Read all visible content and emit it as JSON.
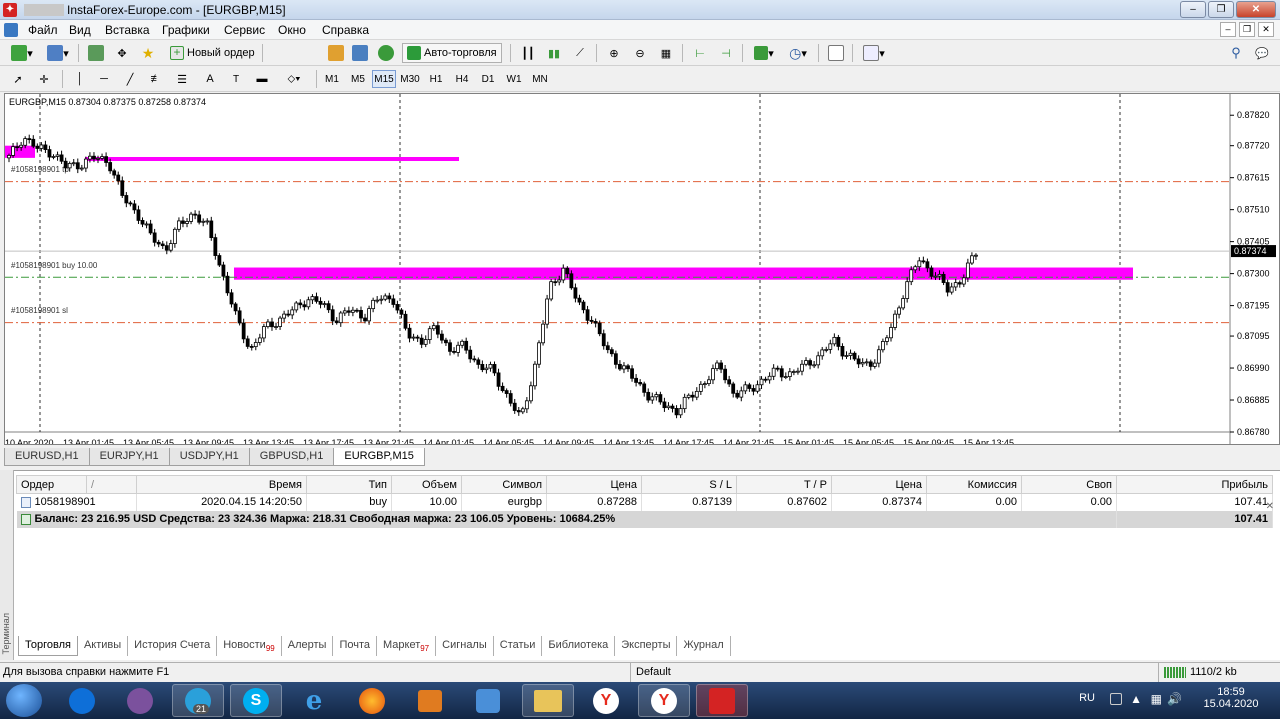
{
  "window": {
    "title": "InstaForex-Europe.com - [EURGBP,M15]",
    "buttons": [
      "–",
      "❐",
      "✕"
    ]
  },
  "menu": [
    "Файл",
    "Вид",
    "Вставка",
    "Графики",
    "Сервис",
    "Окно",
    "Справка"
  ],
  "toolbar": {
    "new_order": "Новый ордер",
    "auto_trading": "Авто-торговля",
    "draw_text": "A"
  },
  "timeframes": [
    "M1",
    "M5",
    "M15",
    "M30",
    "H1",
    "H4",
    "D1",
    "W1",
    "MN"
  ],
  "active_timeframe": "M15",
  "chart": {
    "header": "EURGBP,M15  0.87304 0.87375 0.87258 0.87374",
    "label_tp": "#1058198901 tp",
    "label_buy": "#1058198901 buy 10.00",
    "label_sl": "#1058198901 sl",
    "price_labels": [
      "0.87820",
      "0.87720",
      "0.87615",
      "0.87510",
      "0.87405",
      "0.87300",
      "0.87195",
      "0.87095",
      "0.86990",
      "0.86885",
      "0.86780"
    ],
    "current_price": "0.87374",
    "time_labels": [
      "10 Apr 2020",
      "13 Apr 01:45",
      "13 Apr 05:45",
      "13 Apr 09:45",
      "13 Apr 13:45",
      "13 Apr 17:45",
      "13 Apr 21:45",
      "14 Apr 01:45",
      "14 Apr 05:45",
      "14 Apr 09:45",
      "14 Apr 13:45",
      "14 Apr 17:45",
      "14 Apr 21:45",
      "15 Apr 01:45",
      "15 Apr 05:45",
      "15 Apr 09:45",
      "15 Apr 13:45"
    ]
  },
  "chart_data": {
    "type": "candlestick",
    "symbol": "EURGBP",
    "timeframe": "M15",
    "ohlc_current": {
      "open": 0.87304,
      "high": 0.87375,
      "low": 0.87258,
      "close": 0.87374
    },
    "ylim": [
      0.8678,
      0.8787
    ],
    "levels": {
      "tp": 0.87602,
      "entry": 0.87288,
      "sl": 0.87139
    },
    "zones": [
      {
        "price_top": 0.8772,
        "price_bottom": 0.8768,
        "color": "#ff00ff"
      },
      {
        "price_top": 0.8732,
        "price_bottom": 0.8728,
        "color": "#ff00ff"
      }
    ],
    "close_path": [
      0.8768,
      0.8775,
      0.8771,
      0.877,
      0.8765,
      0.8766,
      0.8768,
      0.8767,
      0.8755,
      0.875,
      0.8742,
      0.8738,
      0.8746,
      0.875,
      0.8745,
      0.873,
      0.8715,
      0.8705,
      0.8712,
      0.8715,
      0.8718,
      0.8722,
      0.872,
      0.8715,
      0.8718,
      0.8716,
      0.8722,
      0.8722,
      0.871,
      0.8708,
      0.8712,
      0.8705,
      0.8706,
      0.87,
      0.8698,
      0.869,
      0.8682,
      0.87,
      0.8725,
      0.8732,
      0.872,
      0.8715,
      0.8705,
      0.87,
      0.8695,
      0.869,
      0.8687,
      0.8685,
      0.869,
      0.8695,
      0.87,
      0.869,
      0.8692,
      0.8695,
      0.8698,
      0.8697,
      0.87,
      0.8703,
      0.8708,
      0.8703,
      0.87,
      0.8702,
      0.8712,
      0.8725,
      0.8735,
      0.873,
      0.8725,
      0.8728,
      0.8737
    ]
  },
  "symbol_tabs": [
    "EURUSD,H1",
    "EURJPY,H1",
    "USDJPY,H1",
    "GBPUSD,H1",
    "EURGBP,M15"
  ],
  "active_symbol_tab": "EURGBP,M15",
  "terminal": {
    "columns": [
      "Ордер",
      "/",
      "Время",
      "Тип",
      "Объем",
      "Символ",
      "Цена",
      "S / L",
      "T / P",
      "Цена",
      "Комиссия",
      "Своп",
      "Прибыль"
    ],
    "rows": [
      {
        "order": "1058198901",
        "time": "2020.04.15 14:20:50",
        "type": "buy",
        "volume": "10.00",
        "symbol": "eurgbp",
        "price": "0.87288",
        "sl": "0.87139",
        "tp": "0.87602",
        "cur_price": "0.87374",
        "commission": "0.00",
        "swap": "0.00",
        "profit": "107.41"
      }
    ],
    "balance_line": "Баланс: 23 216.95 USD  Средства: 23 324.36  Маржа: 218.31  Свободная маржа: 23 106.05  Уровень: 10684.25%",
    "balance_profit": "107.41",
    "side_label": "Терминал"
  },
  "bottom_tabs": [
    {
      "label": "Торговля",
      "badge": ""
    },
    {
      "label": "Активы",
      "badge": ""
    },
    {
      "label": "История Счета",
      "badge": ""
    },
    {
      "label": "Новости",
      "badge": "99"
    },
    {
      "label": "Алерты",
      "badge": ""
    },
    {
      "label": "Почта",
      "badge": ""
    },
    {
      "label": "Маркет",
      "badge": "97"
    },
    {
      "label": "Сигналы",
      "badge": ""
    },
    {
      "label": "Статьи",
      "badge": ""
    },
    {
      "label": "Библиотека",
      "badge": ""
    },
    {
      "label": "Эксперты",
      "badge": ""
    },
    {
      "label": "Журнал",
      "badge": ""
    }
  ],
  "status": {
    "help": "Для вызова справки нажмите F1",
    "profile": "Default",
    "traffic": "1110/2 kb"
  },
  "taskbar": {
    "telegram_badge": "21",
    "lang": "RU",
    "time": "18:59",
    "date": "15.04.2020"
  },
  "colors": {
    "zone": "#ff00ff",
    "tp_sl_line": "#e0603a",
    "entry_line": "#3a9a3a",
    "bull": "#000000",
    "bear": "#000000"
  }
}
